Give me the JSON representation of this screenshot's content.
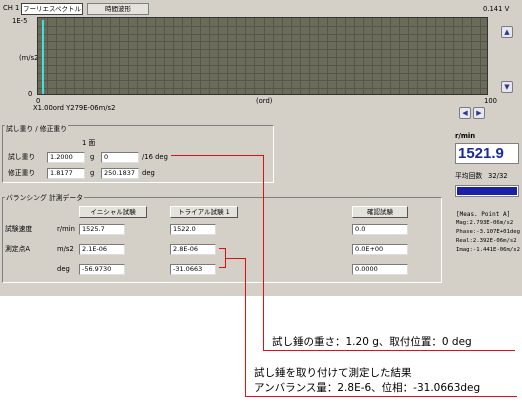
{
  "header": {
    "channel": "CH 1",
    "tabs": [
      {
        "label": "フーリエスペクトル",
        "active": true
      },
      {
        "label": "時間波形",
        "active": false
      }
    ],
    "voltage": "0.141 V"
  },
  "plot": {
    "y_top": "1E-5",
    "y_unit": "(m/s2)",
    "y_bottom": "0",
    "x_left": "0",
    "x_unit": "(ord)",
    "x_right": "100",
    "cursor_readout": "X1.00ord Y279E-06m/s2"
  },
  "trial": {
    "section_title": "試し重り / 修正重り",
    "column_header": "1 面",
    "trial_weight_label": "試し重り",
    "trial_weight_value": "1.2000",
    "trial_weight_unit": "g",
    "trial_position_value": "0",
    "trial_position_unit": "/16 deg",
    "correction_label": "修正重り",
    "correction_value": "1.8177",
    "correction_unit": "g",
    "correction_angle_value": "250.1837",
    "correction_angle_unit": "deg"
  },
  "balancing": {
    "section_title": "バランシング 計測データ",
    "initial_button": "イニシャル試験",
    "trial_button": "トライアル試験 1",
    "confirm_button": "確認試験",
    "rows": [
      {
        "label": "試験速度",
        "unit": "r/min",
        "initial": "1525.7",
        "trial": "1522.0",
        "confirm": "0.0"
      },
      {
        "label": "測定点A",
        "unit": "m/s2",
        "initial": "2.1E-06",
        "trial": "2.8E-06",
        "confirm": "0.0E+00"
      },
      {
        "label": "",
        "unit": "deg",
        "initial": "-56.9730",
        "trial": "-31.0663",
        "confirm": "0.0000"
      }
    ]
  },
  "right_panel": {
    "rpm_label": "r/min",
    "rpm_value": "1521.9",
    "avg_label": "平均回数",
    "avg_value": "32/32",
    "meas_title": "[Meas. Point A]",
    "meas_lines": [
      "Mag:2.793E-06m/s2",
      "Phase:-3.107E+01deg",
      "Real:2.392E-06m/s2",
      "Imag:-1.441E-06m/s2"
    ]
  },
  "annotations": {
    "a1": "試し錘の重さ：1.20 g、取付位置：0 deg",
    "a2_line1": "試し錘を取り付けて測定した結果",
    "a2_line2": "アンバランス量：2.8E-6、位相：-31.0663deg"
  },
  "colors": {
    "panel": "#d4d0c8",
    "plot_bg": "#6b6b5a",
    "accent_blue": "#1a20a8",
    "rpm_text": "#1a2a9a",
    "annotation_red": "#e01010",
    "peak": "#40e0e0"
  },
  "icons": {
    "scroll_up": "▲",
    "scroll_down": "▼",
    "scroll_left": "◀",
    "scroll_right": "▶"
  }
}
